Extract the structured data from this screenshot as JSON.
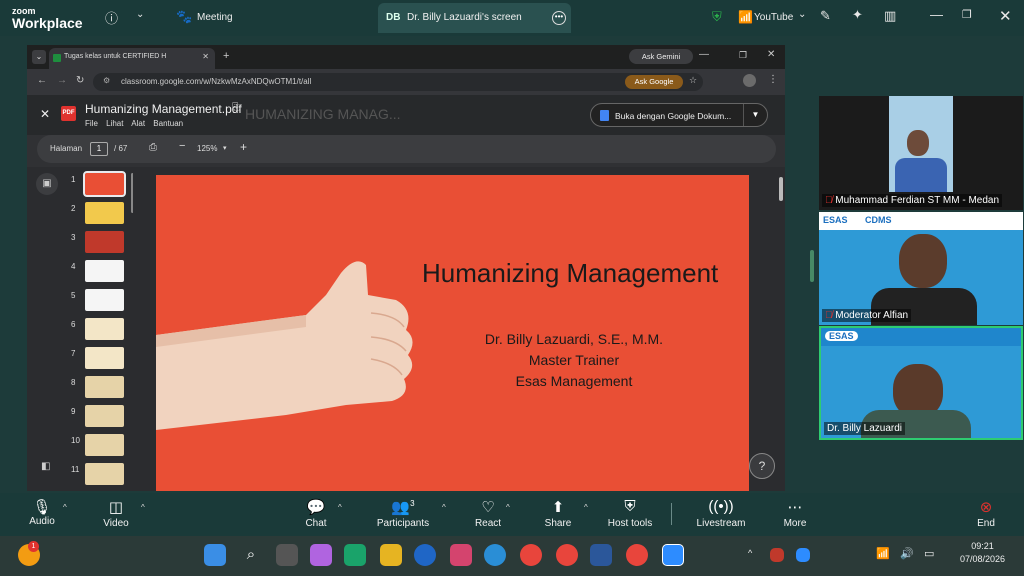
{
  "app": {
    "logo_top": "zoom",
    "logo_bottom": "Workplace",
    "meeting_label": "Meeting"
  },
  "share_tab": {
    "initials": "DB",
    "label": "Dr. Billy Lazuardi's screen"
  },
  "top_right": {
    "youtube": "YouTube"
  },
  "browser": {
    "tab_title": "Tugas kelas untuk CERTIFIED H",
    "ask_gemini": "Ask Gemini",
    "url": "classroom.google.com/w/NzkwMzAxNDQwOTM1/t/all",
    "ask_google": "Ask Google"
  },
  "pdf": {
    "filename": "Humanizing Management.pdf",
    "menu": [
      "File",
      "Lihat",
      "Alat",
      "Bantuan"
    ],
    "ghost_title": "HUMANIZING MANAG...",
    "open_with": "Buka dengan Google Dokum...",
    "page_label": "Halaman",
    "page_current": "1",
    "page_total": "/  67",
    "zoom": "125%",
    "thumb_numbers": [
      "1",
      "2",
      "3",
      "4",
      "5",
      "6",
      "7",
      "8",
      "9",
      "10",
      "11"
    ]
  },
  "slide": {
    "title": "Humanizing Management",
    "lines": [
      "Dr. Billy Lazuardi, S.E., M.M.",
      "Master Trainer",
      "Esas Management"
    ]
  },
  "participants": [
    {
      "name": "Muhammad Ferdian ST MM - Medan",
      "muted": true
    },
    {
      "name": "Moderator Alfian",
      "muted": true,
      "logos": [
        "ESAS",
        "CDMS"
      ]
    },
    {
      "name": "Dr. Billy Lazuardi",
      "muted": false,
      "logos": [
        "ESAS"
      ]
    }
  ],
  "toolbar": {
    "audio": "Audio",
    "video": "Video",
    "chat": "Chat",
    "participants": "Participants",
    "participants_count": "3",
    "react": "React",
    "share": "Share",
    "host_tools": "Host tools",
    "livestream": "Livestream",
    "more": "More",
    "end": "End"
  },
  "taskbar": {
    "time": "09:21",
    "date": "07/08/2026",
    "notif_badge": "1"
  },
  "colors": {
    "zoom_bg": "#1a3a39",
    "slide_bg": "#e94f35",
    "end_red": "#e0322e"
  }
}
